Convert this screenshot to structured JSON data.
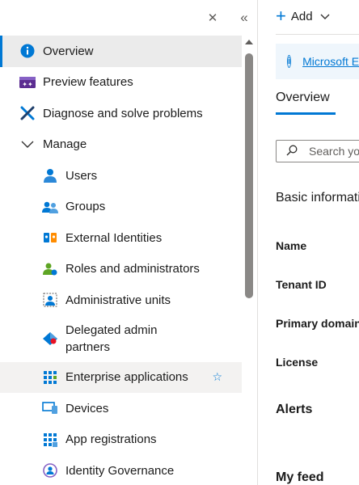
{
  "nav": {
    "top_controls": {
      "close_glyph": "✕",
      "collapse_glyph": "«"
    },
    "items": [
      {
        "label": "Overview",
        "icon": "info-icon",
        "selected": true
      },
      {
        "label": "Preview features",
        "icon": "preview-features-icon"
      },
      {
        "label": "Diagnose and solve problems",
        "icon": "tools-icon"
      },
      {
        "label": "Manage",
        "icon": "chevron-down-icon",
        "expanded": true
      },
      {
        "label": "Users",
        "icon": "user-icon"
      },
      {
        "label": "Groups",
        "icon": "groups-icon"
      },
      {
        "label": "External Identities",
        "icon": "external-identities-icon"
      },
      {
        "label": "Roles and administrators",
        "icon": "roles-icon"
      },
      {
        "label": "Administrative units",
        "icon": "admin-units-icon"
      },
      {
        "label": "Delegated admin partners",
        "icon": "delegated-admin-icon"
      },
      {
        "label": "Enterprise applications",
        "icon": "enterprise-apps-icon",
        "hovered": true,
        "favorite_glyph": "☆"
      },
      {
        "label": "Devices",
        "icon": "devices-icon"
      },
      {
        "label": "App registrations",
        "icon": "app-registrations-icon"
      },
      {
        "label": "Identity Governance",
        "icon": "identity-governance-icon"
      }
    ]
  },
  "main": {
    "toolbar": {
      "add_label": "Add"
    },
    "banner": {
      "link_text": "Microsoft Entra ID"
    },
    "tabs": [
      {
        "label": "Overview",
        "active": true
      }
    ],
    "search": {
      "placeholder": "Search your tenant"
    },
    "sections": {
      "basic_info": "Basic information",
      "alerts": "Alerts",
      "my_feed": "My feed"
    },
    "properties": {
      "name": "Name",
      "tenant_id": "Tenant ID",
      "primary_domain": "Primary domain",
      "license": "License"
    }
  },
  "colors": {
    "accent": "#0078d4",
    "selected_bg": "#ebebeb",
    "hover_bg": "#f3f2f1",
    "banner_bg": "#eff6fc"
  }
}
